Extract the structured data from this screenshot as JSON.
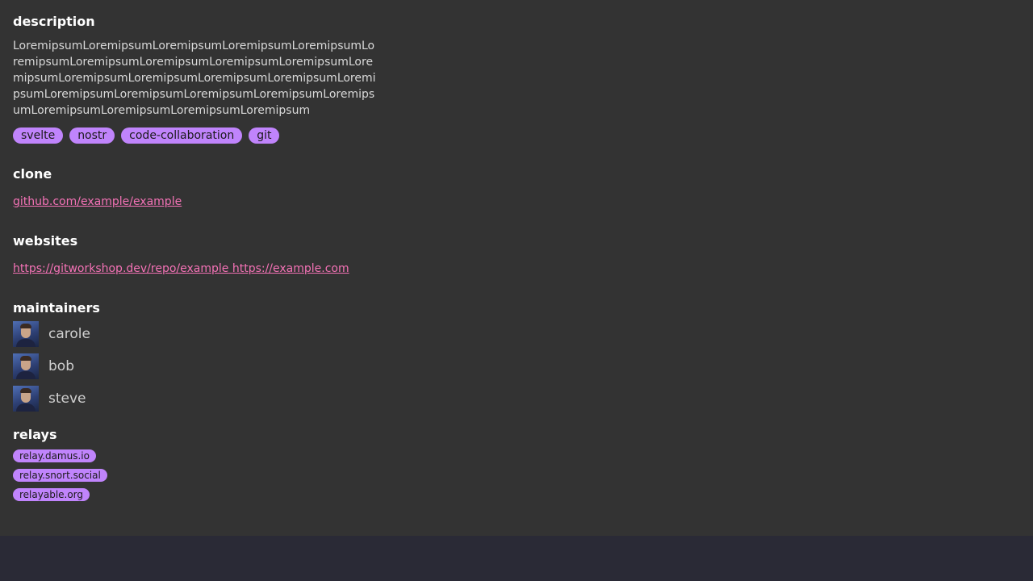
{
  "description": {
    "heading": "description",
    "text": "LoremipsumLoremipsumLoremipsumLoremipsumLoremipsumLoremipsumLoremipsumLoremipsumLoremipsumLoremipsumLoremipsumLoremipsumLoremipsumLoremipsumLoremipsumLoremipsumLoremipsumLoremipsumLoremipsumLoremipsumLoremipsumLoremipsumLoremipsumLoremipsumLoremipsum",
    "tags": [
      "svelte",
      "nostr",
      "code-collaboration",
      "git"
    ]
  },
  "clone": {
    "heading": "clone",
    "url": "github.com/example/example"
  },
  "websites": {
    "heading": "websites",
    "links": [
      "https://gitworkshop.dev/repo/example",
      "https://example.com"
    ]
  },
  "maintainers": {
    "heading": "maintainers",
    "people": [
      {
        "name": "carole",
        "avatar": "avatar-photo"
      },
      {
        "name": "bob",
        "avatar": "avatar-photo"
      },
      {
        "name": "steve",
        "avatar": "avatar-photo"
      }
    ]
  },
  "relays": {
    "heading": "relays",
    "items": [
      "relay.damus.io",
      "relay.snort.social",
      "relayable.org"
    ]
  },
  "colors": {
    "panel_bg": "#333333",
    "page_bg": "#2a2a36",
    "tag_bg": "#c084fc",
    "link": "#f472b6"
  }
}
